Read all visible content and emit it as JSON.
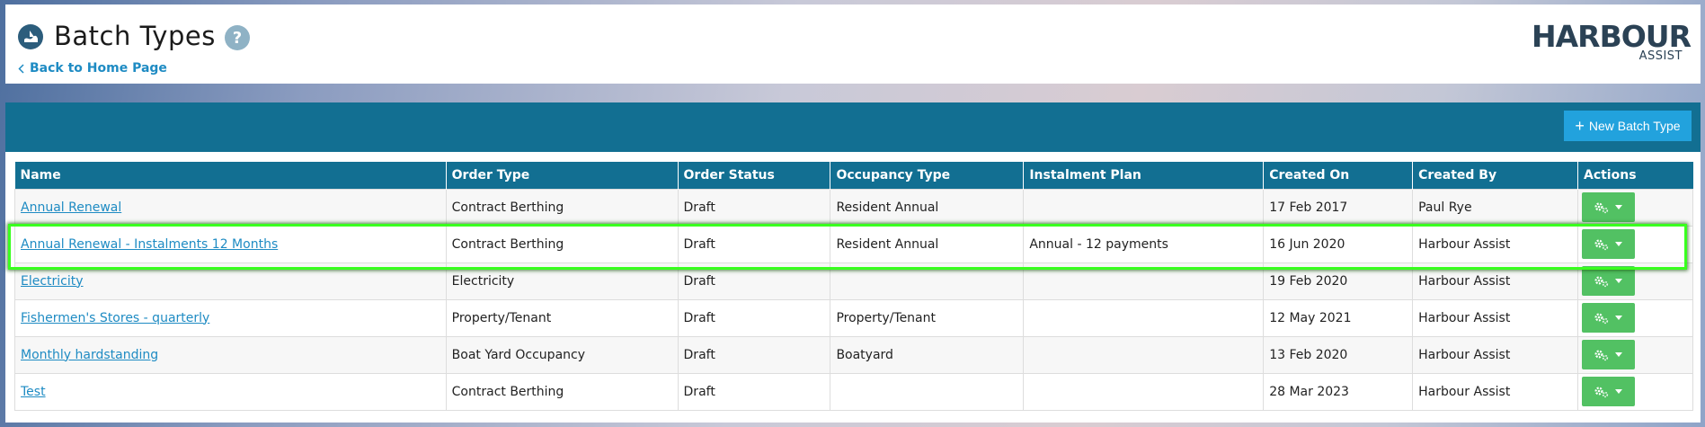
{
  "header": {
    "title": "Batch Types",
    "help_label": "?",
    "back_label": "Back to Home Page",
    "logo_main": "HARBOUR",
    "logo_sub": "ASSIST"
  },
  "toolbar": {
    "new_button_label": "New Batch Type",
    "new_button_icon": "plus-icon"
  },
  "table": {
    "headers": [
      "Name",
      "Order Type",
      "Order Status",
      "Occupancy Type",
      "Instalment Plan",
      "Created On",
      "Created By",
      "Actions"
    ],
    "rows": [
      {
        "name": "Annual Renewal",
        "order_type": "Contract Berthing",
        "order_status": "Draft",
        "occupancy_type": "Resident Annual",
        "instalment_plan": "",
        "created_on": "17 Feb 2017",
        "created_by": "Paul Rye"
      },
      {
        "name": "Annual Renewal - Instalments 12 Months",
        "order_type": "Contract Berthing",
        "order_status": "Draft",
        "occupancy_type": "Resident Annual",
        "instalment_plan": "Annual - 12 payments",
        "created_on": "16 Jun 2020",
        "created_by": "Harbour Assist"
      },
      {
        "name": "Electricity",
        "order_type": "Electricity",
        "order_status": "Draft",
        "occupancy_type": "",
        "instalment_plan": "",
        "created_on": "19 Feb 2020",
        "created_by": "Harbour Assist"
      },
      {
        "name": "Fishermen's Stores - quarterly",
        "order_type": "Property/Tenant",
        "order_status": "Draft",
        "occupancy_type": "Property/Tenant",
        "instalment_plan": "",
        "created_on": "12 May 2021",
        "created_by": "Harbour Assist"
      },
      {
        "name": "Monthly hardstanding",
        "order_type": "Boat Yard Occupancy",
        "order_status": "Draft",
        "occupancy_type": "Boatyard",
        "instalment_plan": "",
        "created_on": "13 Feb 2020",
        "created_by": "Harbour Assist"
      },
      {
        "name": "Test",
        "order_type": "Contract Berthing",
        "order_status": "Draft",
        "occupancy_type": "",
        "instalment_plan": "",
        "created_on": "28 Mar 2023",
        "created_by": "Harbour Assist"
      }
    ]
  },
  "colors": {
    "toolbar": "#126f92",
    "new_button": "#22a2dd",
    "action_button": "#52c163",
    "link": "#1e8bc3",
    "highlight": "#39ff1e"
  }
}
